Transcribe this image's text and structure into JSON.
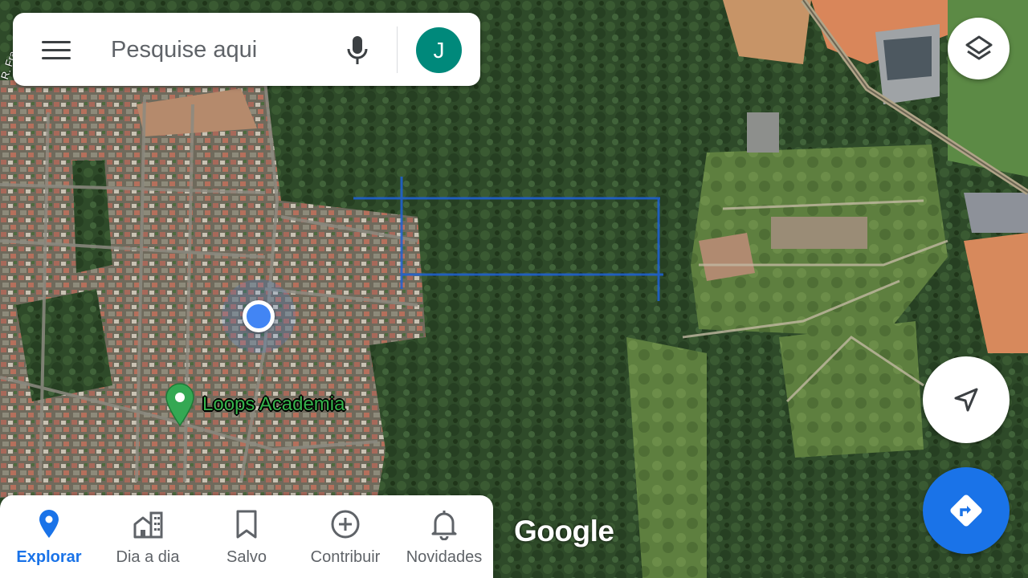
{
  "search": {
    "placeholder": "Pesquise aqui",
    "avatar_letter": "J",
    "avatar_color": "#00897b"
  },
  "icons": {
    "menu": "menu-icon",
    "mic": "mic-icon",
    "layers": "layers-icon",
    "location": "navigation-arrow-icon",
    "directions": "directions-icon"
  },
  "map": {
    "type": "satellite",
    "place_label": "Loops Academia",
    "street_label": "R. Fra",
    "watermark": "Google",
    "highlight_color": "#1e62d6",
    "user_dot_color": "#4285f4",
    "pin_color": "#34a853"
  },
  "bottom_nav": {
    "items": [
      {
        "label": "Explorar",
        "icon": "location-pin-icon",
        "active": true
      },
      {
        "label": "Dia a dia",
        "icon": "city-icon",
        "active": false
      },
      {
        "label": "Salvo",
        "icon": "bookmark-icon",
        "active": false
      },
      {
        "label": "Contribuir",
        "icon": "add-circle-icon",
        "active": false
      },
      {
        "label": "Novidades",
        "icon": "bell-icon",
        "active": false
      }
    ],
    "active_color": "#1a73e8",
    "inactive_color": "#5f6368"
  }
}
